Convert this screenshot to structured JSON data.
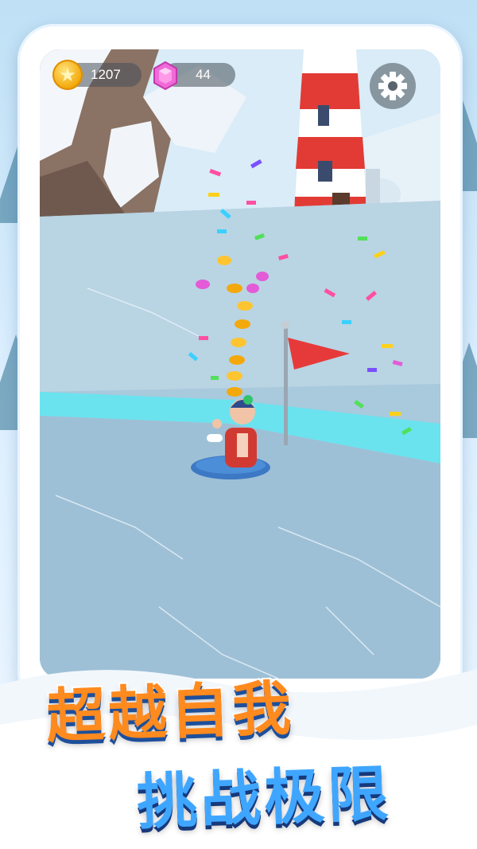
{
  "hud": {
    "coins": "1207",
    "gems": "44",
    "coin_icon": "gold-star-coin",
    "gem_icon": "pink-gem",
    "settings_icon": "gear"
  },
  "headline": {
    "line1": "超越自我",
    "line2": "挑战极限"
  },
  "colors": {
    "headline_line1": "#ff8a1e",
    "headline_line2": "#3fa6ff",
    "ice": "#a9c9dc",
    "flag": "#e63a3a",
    "lighthouse_red": "#e23b35"
  }
}
